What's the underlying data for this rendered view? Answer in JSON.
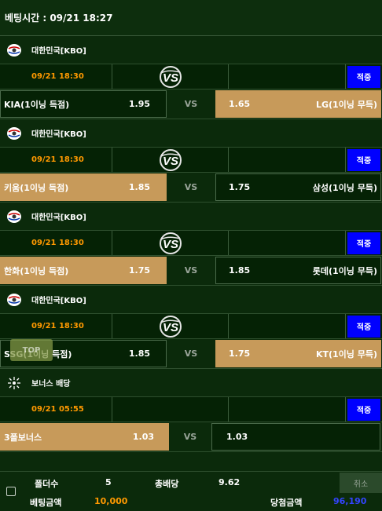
{
  "header": {
    "bet_time": "베팅시간 : 09/21 18:27"
  },
  "icons": {
    "league": "korea-flag-ball-icon",
    "bonus": "sparkle-icon",
    "vs": "vs-logo-icon"
  },
  "colors": {
    "selected": "#c79a5a",
    "apply": "#0000ff",
    "time": "#ff9900",
    "total_win": "#3344ff"
  },
  "games": [
    {
      "league": "대한민국[KBO]",
      "time": "09/21 18:30",
      "apply_label": "적중",
      "vs_label": "VS",
      "home": {
        "team": "KIA(1이닝 득점)",
        "odds": "1.95",
        "selected": false
      },
      "away": {
        "team": "LG(1이닝 무득)",
        "odds": "1.65",
        "selected": true
      }
    },
    {
      "league": "대한민국[KBO]",
      "time": "09/21 18:30",
      "apply_label": "적중",
      "vs_label": "VS",
      "home": {
        "team": "키움(1이닝 득점)",
        "odds": "1.85",
        "selected": true
      },
      "away": {
        "team": "삼성(1이닝 무득)",
        "odds": "1.75",
        "selected": false
      }
    },
    {
      "league": "대한민국[KBO]",
      "time": "09/21 18:30",
      "apply_label": "적중",
      "vs_label": "VS",
      "home": {
        "team": "한화(1이닝 득점)",
        "odds": "1.75",
        "selected": true
      },
      "away": {
        "team": "롯데(1이닝 무득)",
        "odds": "1.85",
        "selected": false
      }
    },
    {
      "league": "대한민국[KBO]",
      "time": "09/21 18:30",
      "apply_label": "적중",
      "vs_label": "VS",
      "home": {
        "team": "SSG(1이닝 득점)",
        "odds": "1.85",
        "selected": false
      },
      "away": {
        "team": "KT(1이닝 무득)",
        "odds": "1.75",
        "selected": true
      }
    }
  ],
  "bonus": {
    "league": "보너스 배당",
    "time": "09/21 05:55",
    "apply_label": "적중",
    "vs_label": "VS",
    "home": {
      "team": "3폴보너스",
      "odds": "1.03",
      "selected": true
    },
    "away": {
      "odds": "1.03"
    }
  },
  "top_button": "TOP",
  "footer": {
    "folder_label": "폴더수",
    "folder_value": "5",
    "total_odds_label": "총배당",
    "total_odds_value": "9.62",
    "cancel_label": "취소",
    "bet_amount_label": "베팅금액",
    "bet_amount_value": "10,000",
    "win_amount_label": "당첨금액",
    "win_amount_value": "96,190"
  }
}
